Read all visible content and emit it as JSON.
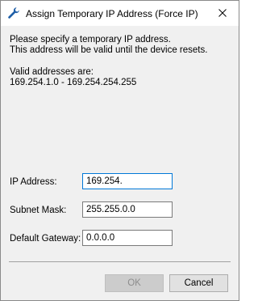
{
  "window": {
    "title": "Assign Temporary IP Address (Force IP)",
    "title_icon": "wrench-icon",
    "close_icon": "close-icon"
  },
  "instructions": {
    "line1": "Please specify a temporary IP address.",
    "line2": "This address will be valid until the device resets."
  },
  "valid_range": {
    "label": "Valid addresses are:",
    "range": "169.254.1.0 - 169.254.254.255"
  },
  "fields": {
    "ip_address": {
      "label": "IP Address:",
      "value": "169.254."
    },
    "subnet_mask": {
      "label": "Subnet Mask:",
      "value": "255.255.0.0"
    },
    "default_gateway": {
      "label": "Default Gateway:",
      "value": "0.0.0.0"
    }
  },
  "buttons": {
    "ok": "OK",
    "cancel": "Cancel"
  },
  "colors": {
    "dialog_background": "#f0f0f0",
    "titlebar_background": "#ffffff",
    "focus_border": "#0078d7",
    "icon": "#1f5fa8"
  }
}
